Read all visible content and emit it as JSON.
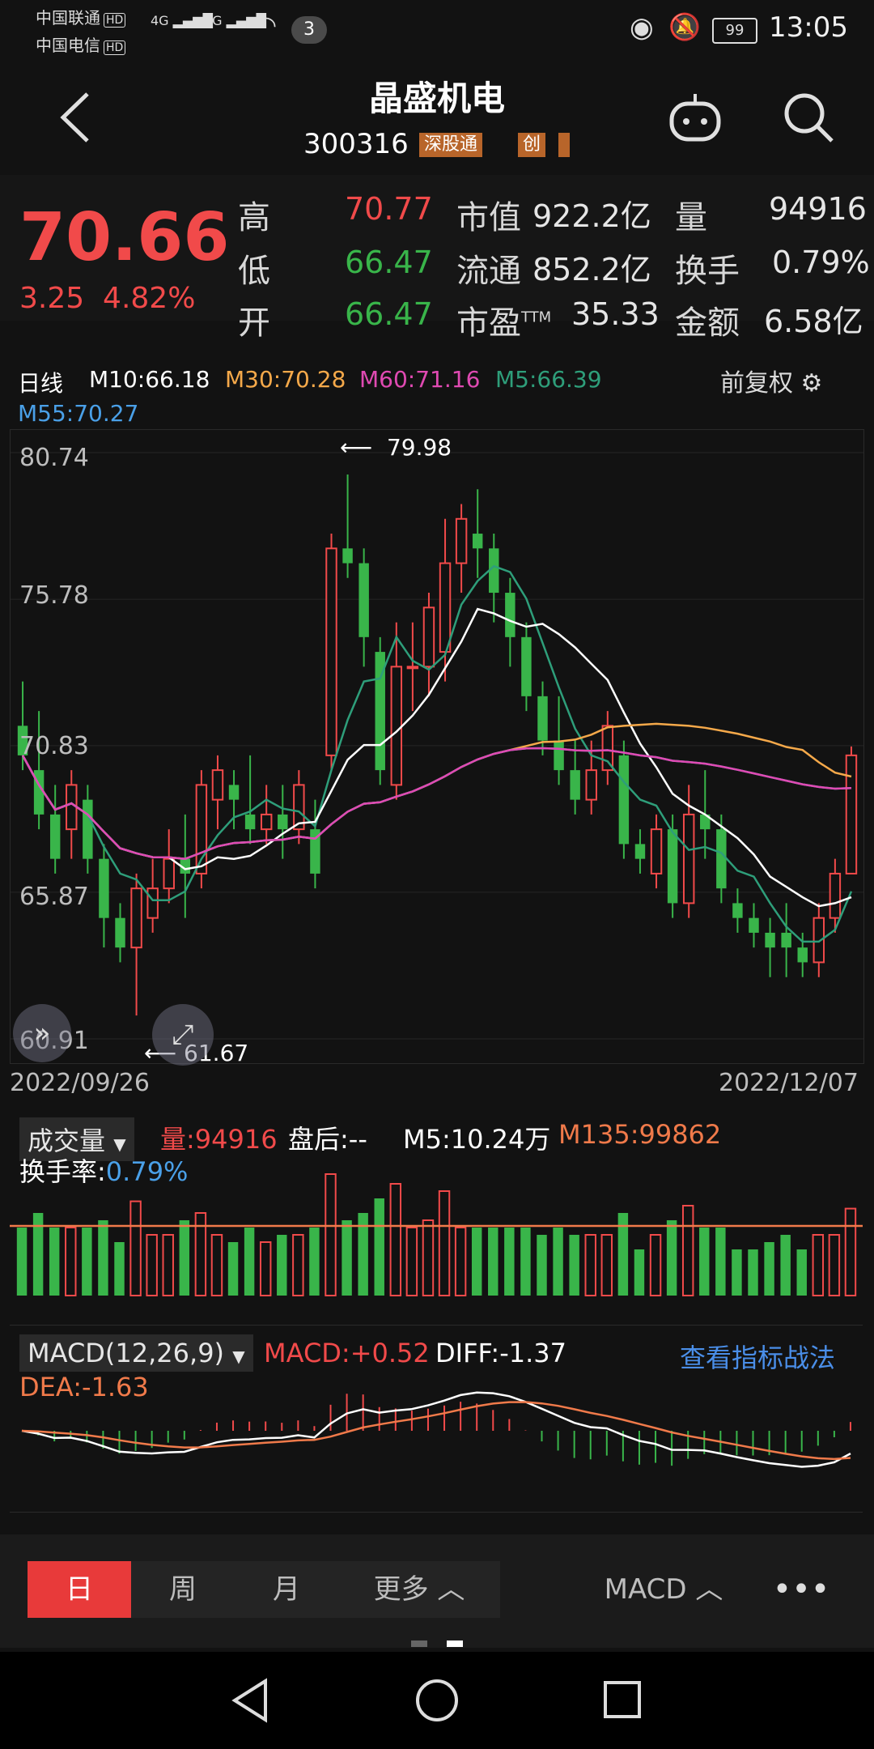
{
  "status": {
    "carrier1": "中国联通",
    "carrier2": "中国电信",
    "hd": "HD",
    "net": "4G",
    "notifications": "3",
    "battery": "99",
    "time": "13:05"
  },
  "header": {
    "title": "晶盛机电",
    "code": "300316",
    "tag1": "深股通",
    "tag2": "创"
  },
  "quote": {
    "price": "70.66",
    "change": "3.25",
    "pct": "4.82%",
    "high_label": "高",
    "high": "70.77",
    "low_label": "低",
    "low": "66.47",
    "open_label": "开",
    "open": "66.47",
    "mcap_label": "市值",
    "mcap": "922.2亿",
    "float_label": "流通",
    "float": "852.2亿",
    "pe_label": "市盈",
    "pe_sup": "TTM",
    "pe": "35.33",
    "vol_label": "量",
    "vol": "94916",
    "turn_label": "换手",
    "turn": "0.79%",
    "amt_label": "金额",
    "amt": "6.58亿"
  },
  "kline": {
    "period": "日线",
    "m10": "M10:66.18",
    "m30": "M30:70.28",
    "m60": "M60:71.16",
    "m5": "M5:66.39",
    "m55": "M55:70.27",
    "adjust": "前复权",
    "y_labels": [
      "80.74",
      "75.78",
      "70.83",
      "65.87",
      "60.91"
    ],
    "max_label": "79.98",
    "min_label": "61.67",
    "date_start": "2022/09/26",
    "date_end": "2022/12/07"
  },
  "volume": {
    "selector": "成交量",
    "vol": "量:94916",
    "after": "盘后:--",
    "m5": "M5:10.24万",
    "m135": "M135:99862",
    "turn_label": "换手率:",
    "turn": "0.79%"
  },
  "macd": {
    "selector": "MACD(12,26,9)",
    "macd": "MACD:+0.52",
    "diff": "DIFF:-1.37",
    "dea": "DEA:-1.63",
    "link": "查看指标战法"
  },
  "tabs": {
    "day": "日",
    "week": "周",
    "month": "月",
    "more": "更多",
    "indicator": "MACD"
  },
  "chart_data": {
    "type": "candlestick",
    "ylim": [
      60.91,
      80.74
    ],
    "y_ticks": [
      80.74,
      75.78,
      70.83,
      65.87,
      60.91
    ],
    "high_marker": 79.98,
    "low_marker": 61.67,
    "x_start": "2022/09/26",
    "x_end": "2022/12/07",
    "candles": [
      [
        71.5,
        70.5,
        73.0,
        70.0
      ],
      [
        70.0,
        68.5,
        72.0,
        68.0
      ],
      [
        68.5,
        67.0,
        69.5,
        66.5
      ],
      [
        68.0,
        69.5,
        70.0,
        67.0
      ],
      [
        69.0,
        67.0,
        69.5,
        66.5
      ],
      [
        67.0,
        65.0,
        67.5,
        64.0
      ],
      [
        65.0,
        64.0,
        65.5,
        63.5
      ],
      [
        64.0,
        66.0,
        66.5,
        61.7
      ],
      [
        65.0,
        66.0,
        67.0,
        64.5
      ],
      [
        66.0,
        67.0,
        68.0,
        65.5
      ],
      [
        67.0,
        66.5,
        68.5,
        65.0
      ],
      [
        66.5,
        69.5,
        70.0,
        66.0
      ],
      [
        69.0,
        70.0,
        70.5,
        68.0
      ],
      [
        69.5,
        69.0,
        70.0,
        68.0
      ],
      [
        68.5,
        68.0,
        70.5,
        67.5
      ],
      [
        68.0,
        68.5,
        69.5,
        67.5
      ],
      [
        68.5,
        68.0,
        69.5,
        67.0
      ],
      [
        68.0,
        69.5,
        70.0,
        67.5
      ],
      [
        68.0,
        66.5,
        69.0,
        66.0
      ],
      [
        70.5,
        77.5,
        78.0,
        70.0
      ],
      [
        77.5,
        77.0,
        80.0,
        76.5
      ],
      [
        77.0,
        74.5,
        77.5,
        73.5
      ],
      [
        74.0,
        70.0,
        74.5,
        69.5
      ],
      [
        69.5,
        73.5,
        75.0,
        69.0
      ],
      [
        73.5,
        73.5,
        75.0,
        72.0
      ],
      [
        73.5,
        75.5,
        76.0,
        72.5
      ],
      [
        74.0,
        77.0,
        78.5,
        73.0
      ],
      [
        77.0,
        78.5,
        79.0,
        76.0
      ],
      [
        78.0,
        77.5,
        79.5,
        76.5
      ],
      [
        77.5,
        76.0,
        78.0,
        75.0
      ],
      [
        76.0,
        74.5,
        76.5,
        73.5
      ],
      [
        74.5,
        72.5,
        75.0,
        72.0
      ],
      [
        72.5,
        71.0,
        73.0,
        70.5
      ],
      [
        71.0,
        70.0,
        72.5,
        69.5
      ],
      [
        70.0,
        69.0,
        71.0,
        68.5
      ],
      [
        69.0,
        70.0,
        71.0,
        68.5
      ],
      [
        70.0,
        71.5,
        72.0,
        69.5
      ],
      [
        70.5,
        67.5,
        71.0,
        67.0
      ],
      [
        67.5,
        67.0,
        68.0,
        66.5
      ],
      [
        66.5,
        68.0,
        68.5,
        66.0
      ],
      [
        68.0,
        65.5,
        68.5,
        65.0
      ],
      [
        65.5,
        68.5,
        69.5,
        65.0
      ],
      [
        68.5,
        68.0,
        70.0,
        67.0
      ],
      [
        68.0,
        66.0,
        68.5,
        65.5
      ],
      [
        65.5,
        65.0,
        66.0,
        64.5
      ],
      [
        65.0,
        64.5,
        65.5,
        64.0
      ],
      [
        64.5,
        64.0,
        65.0,
        63.0
      ],
      [
        64.5,
        64.0,
        65.5,
        63.0
      ],
      [
        64.0,
        63.5,
        64.5,
        63.0
      ],
      [
        63.5,
        65.0,
        65.5,
        63.0
      ],
      [
        65.0,
        66.5,
        67.0,
        64.5
      ],
      [
        66.5,
        70.5,
        70.8,
        66.5
      ]
    ]
  }
}
